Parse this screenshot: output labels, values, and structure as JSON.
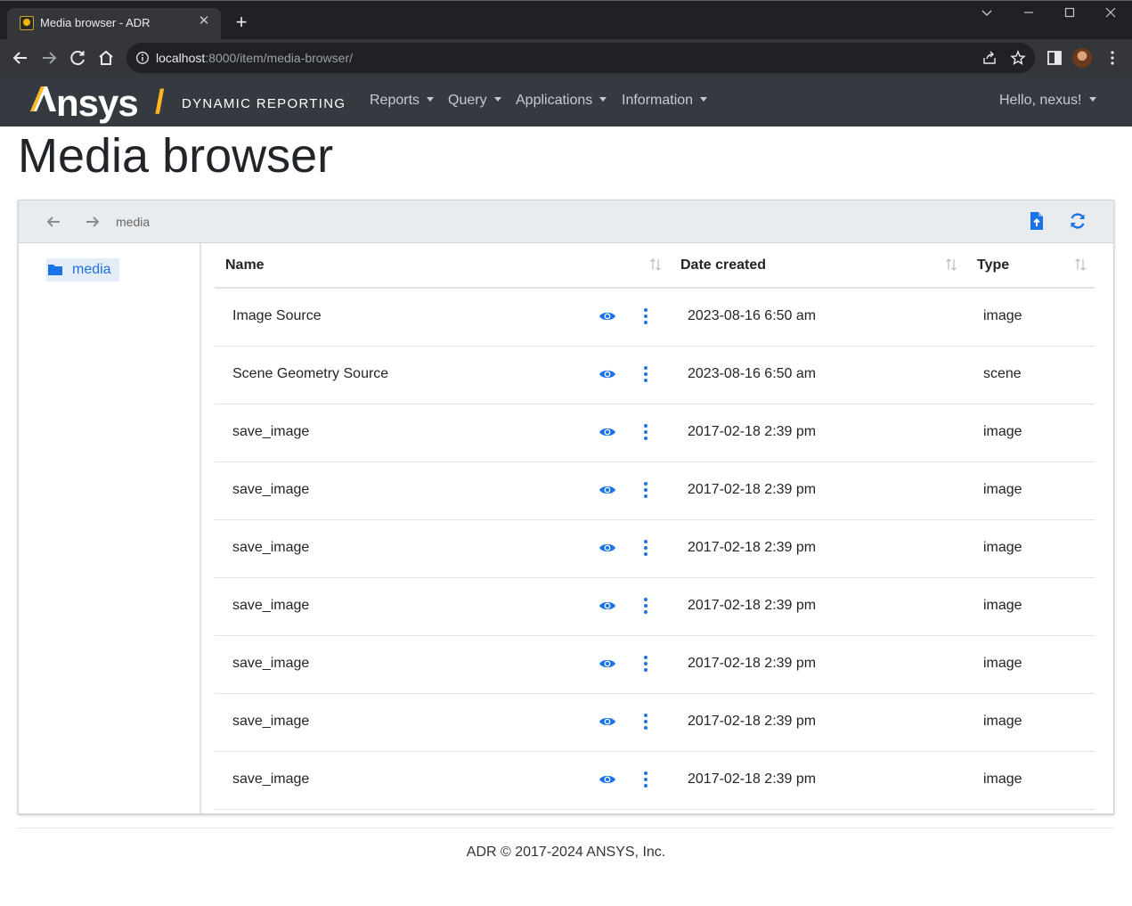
{
  "browser": {
    "tab_title": "Media browser - ADR",
    "tab_close": "✕",
    "new_tab": "+",
    "url_host": "localhost",
    "url_rest": ":8000/item/media-browser/"
  },
  "navbar": {
    "brand_ansys": "nsys",
    "brand_a": "/\\",
    "brand_slash": "/",
    "brand_text": "DYNAMIC REPORTING",
    "menu": [
      {
        "label": "Reports"
      },
      {
        "label": "Query"
      },
      {
        "label": "Applications"
      },
      {
        "label": "Information"
      }
    ],
    "user": "Hello, nexus!"
  },
  "page": {
    "title": "Media browser"
  },
  "media_browser": {
    "path": "media",
    "tree": [
      {
        "label": "media"
      }
    ],
    "columns": {
      "name": "Name",
      "date_created": "Date created",
      "type": "Type"
    },
    "rows": [
      {
        "name": "Image Source",
        "date": "2023-08-16 6:50 am",
        "type": "image"
      },
      {
        "name": "Scene Geometry Source",
        "date": "2023-08-16 6:50 am",
        "type": "scene"
      },
      {
        "name": "save_image",
        "date": "2017-02-18 2:39 pm",
        "type": "image"
      },
      {
        "name": "save_image",
        "date": "2017-02-18 2:39 pm",
        "type": "image"
      },
      {
        "name": "save_image",
        "date": "2017-02-18 2:39 pm",
        "type": "image"
      },
      {
        "name": "save_image",
        "date": "2017-02-18 2:39 pm",
        "type": "image"
      },
      {
        "name": "save_image",
        "date": "2017-02-18 2:39 pm",
        "type": "image"
      },
      {
        "name": "save_image",
        "date": "2017-02-18 2:39 pm",
        "type": "image"
      },
      {
        "name": "save_image",
        "date": "2017-02-18 2:39 pm",
        "type": "image"
      }
    ]
  },
  "footer": {
    "text": "ADR © 2017-2024 ANSYS, Inc."
  },
  "colors": {
    "accent": "#1a73e8",
    "brand_yellow": "#ffb71b",
    "navbar_bg": "#343a40"
  }
}
